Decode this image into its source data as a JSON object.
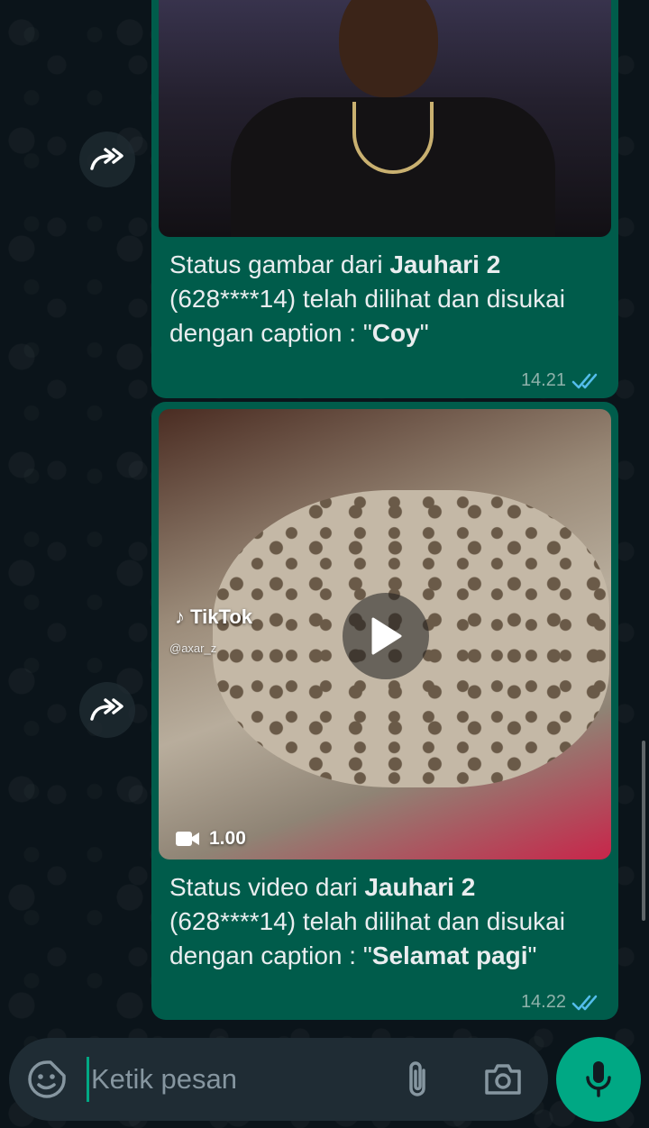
{
  "messages": [
    {
      "caption_prefix": "Status gambar dari ",
      "contact": "Jauhari 2",
      "caption_middle": " (628****14) telah dilihat dan disukai dengan caption : \"",
      "caption_quote": "Coy",
      "caption_suffix": "\"",
      "time": "14.21",
      "media_type": "image"
    },
    {
      "caption_prefix": "Status video dari ",
      "contact": "Jauhari 2",
      "caption_middle": " (628****14) telah dilihat dan disukai dengan caption : \"",
      "caption_quote": "Selamat pagi",
      "caption_suffix": "\"",
      "time": "14.22",
      "media_type": "video",
      "video_duration": "1.00",
      "watermark_brand": "TikTok",
      "watermark_handle": "@axar_z"
    }
  ],
  "composer": {
    "placeholder": "Ketik pesan"
  },
  "colors": {
    "bubble": "#005c4b",
    "background": "#0b141a",
    "accent": "#00a884",
    "read_ticks": "#53bdeb"
  }
}
